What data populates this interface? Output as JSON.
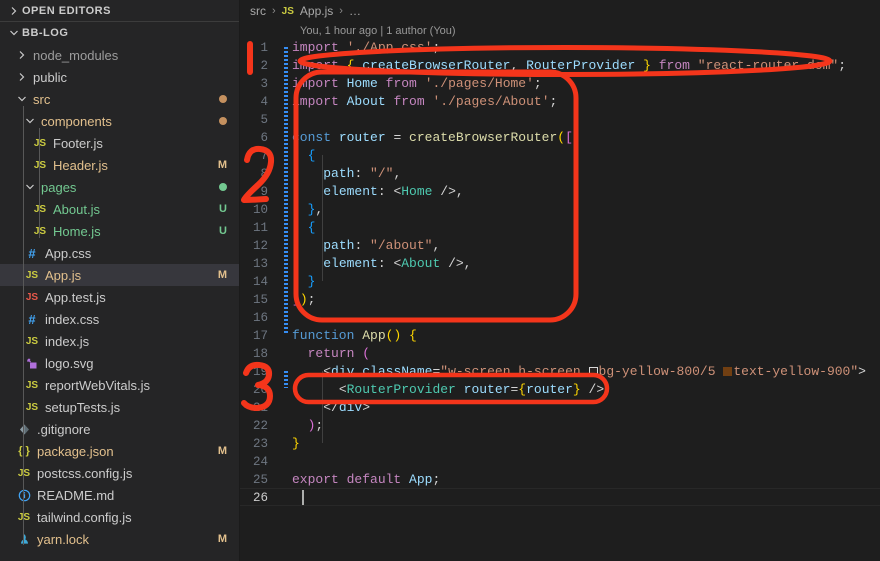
{
  "sidebar": {
    "open_editors": {
      "label": "OPEN EDITORS",
      "expanded": false,
      "icon": "chevron-right-icon"
    },
    "project": {
      "label": "BB-LOG",
      "expanded": true,
      "icon": "chevron-down-icon"
    },
    "items": [
      {
        "label": "node_modules",
        "type": "folder",
        "depth": 1,
        "expanded": false,
        "icon": "chevron-right-icon",
        "color": "#9d9d9d",
        "badge": "",
        "dot": ""
      },
      {
        "label": "public",
        "type": "folder",
        "depth": 1,
        "expanded": false,
        "icon": "chevron-right-icon",
        "color": "#cccccc",
        "badge": "",
        "dot": ""
      },
      {
        "label": "src",
        "type": "folder",
        "depth": 1,
        "expanded": true,
        "icon": "chevron-down-icon",
        "color": "#e2c08d",
        "badge": "",
        "dot": "#c5915f"
      },
      {
        "label": "components",
        "type": "folder",
        "depth": 2,
        "expanded": true,
        "icon": "chevron-down-icon",
        "color": "#e2c08d",
        "badge": "",
        "dot": "#c5915f"
      },
      {
        "label": "Footer.js",
        "type": "js",
        "depth": 3,
        "icon": "js-icon",
        "color": "#cccccc",
        "badge": "",
        "dot": ""
      },
      {
        "label": "Header.js",
        "type": "js",
        "depth": 3,
        "icon": "js-icon",
        "color": "#e2c08d",
        "badge": "M",
        "badge_color": "#e2c08d",
        "dot": ""
      },
      {
        "label": "pages",
        "type": "folder",
        "depth": 2,
        "expanded": true,
        "icon": "chevron-down-icon",
        "color": "#73c991",
        "badge": "",
        "dot": "#73c991"
      },
      {
        "label": "About.js",
        "type": "js",
        "depth": 3,
        "icon": "js-icon",
        "color": "#73c991",
        "badge": "U",
        "badge_color": "#73c991",
        "dot": ""
      },
      {
        "label": "Home.js",
        "type": "js",
        "depth": 3,
        "icon": "js-icon",
        "color": "#73c991",
        "badge": "U",
        "badge_color": "#73c991",
        "dot": ""
      },
      {
        "label": "App.css",
        "type": "css",
        "depth": 2,
        "icon": "css-hash-icon",
        "color": "#cccccc",
        "badge": "",
        "dot": ""
      },
      {
        "label": "App.js",
        "type": "js",
        "depth": 2,
        "icon": "js-icon",
        "color": "#e2c08d",
        "badge": "M",
        "badge_color": "#e2c08d",
        "dot": "",
        "selected": true
      },
      {
        "label": "App.test.js",
        "type": "js-test",
        "depth": 2,
        "icon": "js-test-icon",
        "color": "#cccccc",
        "badge": "",
        "dot": ""
      },
      {
        "label": "index.css",
        "type": "css",
        "depth": 2,
        "icon": "css-hash-icon",
        "color": "#cccccc",
        "badge": "",
        "dot": ""
      },
      {
        "label": "index.js",
        "type": "js",
        "depth": 2,
        "icon": "js-icon",
        "color": "#cccccc",
        "badge": "",
        "dot": ""
      },
      {
        "label": "logo.svg",
        "type": "svg",
        "depth": 2,
        "icon": "svg-icon",
        "color": "#cccccc",
        "badge": "",
        "dot": ""
      },
      {
        "label": "reportWebVitals.js",
        "type": "js",
        "depth": 2,
        "icon": "js-icon",
        "color": "#cccccc",
        "badge": "",
        "dot": ""
      },
      {
        "label": "setupTests.js",
        "type": "js",
        "depth": 2,
        "icon": "js-icon",
        "color": "#cccccc",
        "badge": "",
        "dot": ""
      },
      {
        "label": ".gitignore",
        "type": "git",
        "depth": 1,
        "icon": "git-icon",
        "color": "#cccccc",
        "badge": "",
        "dot": ""
      },
      {
        "label": "package.json",
        "type": "json",
        "depth": 1,
        "icon": "json-braces-icon",
        "color": "#e2c08d",
        "badge": "M",
        "badge_color": "#e2c08d",
        "dot": ""
      },
      {
        "label": "postcss.config.js",
        "type": "js",
        "depth": 1,
        "icon": "js-icon",
        "color": "#cccccc",
        "badge": "",
        "dot": ""
      },
      {
        "label": "README.md",
        "type": "md",
        "depth": 1,
        "icon": "info-circle-icon",
        "color": "#cccccc",
        "badge": "",
        "dot": ""
      },
      {
        "label": "tailwind.config.js",
        "type": "js",
        "depth": 1,
        "icon": "js-icon",
        "color": "#cccccc",
        "badge": "",
        "dot": ""
      },
      {
        "label": "yarn.lock",
        "type": "lock",
        "depth": 1,
        "icon": "yarn-icon",
        "color": "#e2c08d",
        "badge": "M",
        "badge_color": "#e2c08d",
        "dot": ""
      }
    ]
  },
  "editor": {
    "breadcrumb": {
      "folder": "src",
      "file": "App.js",
      "js_badge": "JS",
      "ellipsis": "…",
      "separator": "›"
    },
    "codelens": "You, 1 hour ago | 1 author (You)",
    "lines": [
      {
        "n": 1,
        "tokens": [
          {
            "t": "import",
            "c": "kw"
          },
          {
            "t": " ",
            "c": "plain"
          },
          {
            "t": "'./App.css'",
            "c": "str"
          },
          {
            "t": ";",
            "c": "plain"
          }
        ]
      },
      {
        "n": 2,
        "tokens": [
          {
            "t": "import",
            "c": "kw"
          },
          {
            "t": " ",
            "c": "plain"
          },
          {
            "t": "{",
            "c": "br1"
          },
          {
            "t": " ",
            "c": "plain"
          },
          {
            "t": "createBrowserRouter",
            "c": "var"
          },
          {
            "t": ", ",
            "c": "plain"
          },
          {
            "t": "RouterProvider",
            "c": "var"
          },
          {
            "t": " ",
            "c": "plain"
          },
          {
            "t": "}",
            "c": "br1"
          },
          {
            "t": " ",
            "c": "plain"
          },
          {
            "t": "from",
            "c": "kw"
          },
          {
            "t": " ",
            "c": "plain"
          },
          {
            "t": "\"react-router-dom\"",
            "c": "str"
          },
          {
            "t": ";",
            "c": "plain"
          }
        ]
      },
      {
        "n": 3,
        "tokens": [
          {
            "t": "import",
            "c": "kw"
          },
          {
            "t": " ",
            "c": "plain"
          },
          {
            "t": "Home",
            "c": "var"
          },
          {
            "t": " ",
            "c": "plain"
          },
          {
            "t": "from",
            "c": "kw"
          },
          {
            "t": " ",
            "c": "plain"
          },
          {
            "t": "'./pages/Home'",
            "c": "str"
          },
          {
            "t": ";",
            "c": "plain"
          }
        ]
      },
      {
        "n": 4,
        "tokens": [
          {
            "t": "import",
            "c": "kw"
          },
          {
            "t": " ",
            "c": "plain"
          },
          {
            "t": "About",
            "c": "var"
          },
          {
            "t": " ",
            "c": "plain"
          },
          {
            "t": "from",
            "c": "kw"
          },
          {
            "t": " ",
            "c": "plain"
          },
          {
            "t": "'./pages/About'",
            "c": "str"
          },
          {
            "t": ";",
            "c": "plain"
          }
        ]
      },
      {
        "n": 5,
        "tokens": []
      },
      {
        "n": 6,
        "tokens": [
          {
            "t": "const",
            "c": "kw2"
          },
          {
            "t": " ",
            "c": "plain"
          },
          {
            "t": "router",
            "c": "var"
          },
          {
            "t": " = ",
            "c": "plain"
          },
          {
            "t": "createBrowserRouter",
            "c": "fn"
          },
          {
            "t": "(",
            "c": "br1"
          },
          {
            "t": "[",
            "c": "br2"
          }
        ]
      },
      {
        "n": 7,
        "tokens": [
          {
            "t": "  ",
            "c": "plain"
          },
          {
            "t": "{",
            "c": "br3"
          }
        ]
      },
      {
        "n": 8,
        "tokens": [
          {
            "t": "    ",
            "c": "plain"
          },
          {
            "t": "path",
            "c": "var"
          },
          {
            "t": ": ",
            "c": "plain"
          },
          {
            "t": "\"/\"",
            "c": "str"
          },
          {
            "t": ",",
            "c": "plain"
          }
        ]
      },
      {
        "n": 9,
        "tokens": [
          {
            "t": "    ",
            "c": "plain"
          },
          {
            "t": "element",
            "c": "var"
          },
          {
            "t": ": ",
            "c": "plain"
          },
          {
            "t": "<",
            "c": "punc"
          },
          {
            "t": "Home",
            "c": "cmp"
          },
          {
            "t": " />",
            "c": "punc"
          },
          {
            "t": ",",
            "c": "plain"
          }
        ]
      },
      {
        "n": 10,
        "tokens": [
          {
            "t": "  ",
            "c": "plain"
          },
          {
            "t": "}",
            "c": "br3"
          },
          {
            "t": ",",
            "c": "plain"
          }
        ]
      },
      {
        "n": 11,
        "tokens": [
          {
            "t": "  ",
            "c": "plain"
          },
          {
            "t": "{",
            "c": "br3"
          }
        ]
      },
      {
        "n": 12,
        "tokens": [
          {
            "t": "    ",
            "c": "plain"
          },
          {
            "t": "path",
            "c": "var"
          },
          {
            "t": ": ",
            "c": "plain"
          },
          {
            "t": "\"/about\"",
            "c": "str"
          },
          {
            "t": ",",
            "c": "plain"
          }
        ]
      },
      {
        "n": 13,
        "tokens": [
          {
            "t": "    ",
            "c": "plain"
          },
          {
            "t": "element",
            "c": "var"
          },
          {
            "t": ": ",
            "c": "plain"
          },
          {
            "t": "<",
            "c": "punc"
          },
          {
            "t": "About",
            "c": "cmp"
          },
          {
            "t": " />",
            "c": "punc"
          },
          {
            "t": ",",
            "c": "plain"
          }
        ]
      },
      {
        "n": 14,
        "tokens": [
          {
            "t": "  ",
            "c": "plain"
          },
          {
            "t": "}",
            "c": "br3"
          }
        ]
      },
      {
        "n": 15,
        "tokens": [
          {
            "t": "]",
            "c": "br2"
          },
          {
            "t": ")",
            "c": "br1"
          },
          {
            "t": ";",
            "c": "plain"
          }
        ]
      },
      {
        "n": 16,
        "tokens": []
      },
      {
        "n": 17,
        "tokens": [
          {
            "t": "function",
            "c": "kw2"
          },
          {
            "t": " ",
            "c": "plain"
          },
          {
            "t": "App",
            "c": "fn"
          },
          {
            "t": "() ",
            "c": "br1"
          },
          {
            "t": "{",
            "c": "br1"
          }
        ]
      },
      {
        "n": 18,
        "tokens": [
          {
            "t": "  ",
            "c": "plain"
          },
          {
            "t": "return",
            "c": "kw"
          },
          {
            "t": " ",
            "c": "plain"
          },
          {
            "t": "(",
            "c": "br2"
          }
        ]
      },
      {
        "n": 19,
        "tokens": [
          {
            "t": "    ",
            "c": "plain"
          },
          {
            "t": "<",
            "c": "punc"
          },
          {
            "t": "div",
            "c": "var"
          },
          {
            "t": " ",
            "c": "plain"
          },
          {
            "t": "className",
            "c": "attr"
          },
          {
            "t": "=",
            "c": "plain"
          },
          {
            "t": "\"w-screen h-screen ",
            "c": "str"
          },
          {
            "t": "__SWATCH_WHITE__",
            "c": "swatch"
          },
          {
            "t": "bg-yellow-800/5 ",
            "c": "str"
          },
          {
            "t": "__SWATCH_BROWN__",
            "c": "swatch"
          },
          {
            "t": "text-yellow-900\"",
            "c": "str"
          },
          {
            "t": ">",
            "c": "punc"
          }
        ]
      },
      {
        "n": 20,
        "tokens": [
          {
            "t": "      ",
            "c": "plain"
          },
          {
            "t": "<",
            "c": "punc"
          },
          {
            "t": "RouterProvider",
            "c": "cmp"
          },
          {
            "t": " ",
            "c": "plain"
          },
          {
            "t": "router",
            "c": "attr"
          },
          {
            "t": "=",
            "c": "plain"
          },
          {
            "t": "{",
            "c": "br1"
          },
          {
            "t": "router",
            "c": "var"
          },
          {
            "t": "}",
            "c": "br1"
          },
          {
            "t": " />",
            "c": "punc"
          }
        ]
      },
      {
        "n": 21,
        "tokens": [
          {
            "t": "    ",
            "c": "plain"
          },
          {
            "t": "</",
            "c": "punc"
          },
          {
            "t": "div",
            "c": "var"
          },
          {
            "t": ">",
            "c": "punc"
          }
        ]
      },
      {
        "n": 22,
        "tokens": [
          {
            "t": "  ",
            "c": "plain"
          },
          {
            "t": ")",
            "c": "br2"
          },
          {
            "t": ";",
            "c": "plain"
          }
        ]
      },
      {
        "n": 23,
        "tokens": [
          {
            "t": "}",
            "c": "br1"
          }
        ]
      },
      {
        "n": 24,
        "tokens": []
      },
      {
        "n": 25,
        "tokens": [
          {
            "t": "export",
            "c": "kw"
          },
          {
            "t": " ",
            "c": "plain"
          },
          {
            "t": "default",
            "c": "kw"
          },
          {
            "t": " ",
            "c": "plain"
          },
          {
            "t": "App",
            "c": "var"
          },
          {
            "t": ";",
            "c": "plain"
          }
        ]
      },
      {
        "n": 26,
        "tokens": []
      }
    ],
    "cursor_line": 26,
    "swatches": [
      {
        "name": "bg-yellow-800/5",
        "color": "#2b2422",
        "border": "#d8d8d8"
      },
      {
        "name": "text-yellow-900",
        "color": "#713f12",
        "border": "#713f12"
      }
    ]
  },
  "annotations": {
    "color": "#f4351b",
    "marks": [
      {
        "label": "1",
        "kind": "stroke"
      },
      {
        "label": "2",
        "kind": "digit"
      },
      {
        "label": "3",
        "kind": "digit"
      }
    ]
  }
}
